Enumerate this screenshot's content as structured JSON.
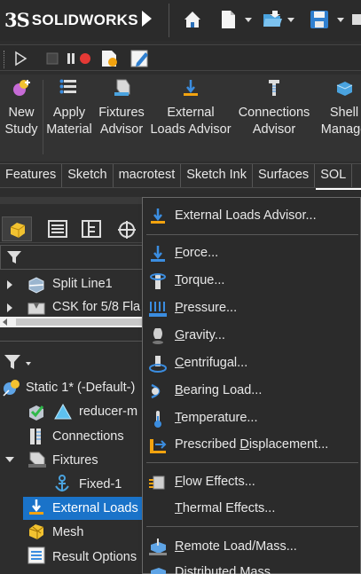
{
  "app": {
    "logo_mark": "3S",
    "logo_text": "SOLIDWORKS"
  },
  "ribbon": {
    "buttons": [
      {
        "line1": "New",
        "line2": "Study",
        "icon": "new-study-icon"
      },
      {
        "line1": "Apply",
        "line2": "Material",
        "icon": "apply-material-icon"
      },
      {
        "line1": "Fixtures",
        "line2": "Advisor",
        "icon": "fixtures-advisor-icon"
      },
      {
        "line1": "External",
        "line2": "Loads Advisor",
        "icon": "external-loads-advisor-icon"
      },
      {
        "line1": "Connections",
        "line2": "Advisor",
        "icon": "connections-advisor-icon"
      },
      {
        "line1": "Shell",
        "line2": "Manage",
        "icon": "shell-manager-icon"
      }
    ]
  },
  "tabs": [
    "Features",
    "Sketch",
    "macrotest",
    "Sketch Ink",
    "Surfaces",
    "SOL"
  ],
  "tree": {
    "top_items": [
      {
        "label": "Split Line1",
        "icon": "split-line-icon"
      },
      {
        "label": "CSK for 5/8 Fla",
        "icon": "hole-wizard-icon"
      }
    ],
    "study": {
      "root": "Static 1* (-Default-)",
      "part": "reducer-m",
      "connections": "Connections",
      "fixtures": "Fixtures",
      "fixed": "Fixed-1",
      "external_loads": "External Loads",
      "mesh": "Mesh",
      "result_options": "Result Options"
    }
  },
  "menu": {
    "items": [
      {
        "pre": "External Loads Advisor...",
        "u": "",
        "post": "",
        "icon": "external-loads-advisor-icon"
      },
      {
        "pre": "",
        "u": "F",
        "post": "orce...",
        "icon": "force-icon"
      },
      {
        "pre": "",
        "u": "T",
        "post": "orque...",
        "icon": "torque-icon"
      },
      {
        "pre": "",
        "u": "P",
        "post": "ressure...",
        "icon": "pressure-icon"
      },
      {
        "pre": "",
        "u": "G",
        "post": "ravity...",
        "icon": "gravity-icon"
      },
      {
        "pre": "",
        "u": "C",
        "post": "entrifugal...",
        "icon": "centrifugal-icon"
      },
      {
        "pre": "",
        "u": "B",
        "post": "earing Load...",
        "icon": "bearing-load-icon"
      },
      {
        "pre": "",
        "u": "T",
        "post": "emperature...",
        "icon": "temperature-icon"
      },
      {
        "pre": "Prescribed ",
        "u": "D",
        "post": "isplacement...",
        "icon": "prescribed-displacement-icon"
      },
      {
        "pre": "",
        "u": "F",
        "post": "low Effects...",
        "icon": "flow-effects-icon"
      },
      {
        "pre": "",
        "u": "T",
        "post": "hermal Effects...",
        "icon": "thermal-effects-icon"
      },
      {
        "pre": "",
        "u": "R",
        "post": "emote Load/Mass...",
        "icon": "remote-load-icon"
      },
      {
        "pre": "Distributed Mass...",
        "u": "",
        "post": "",
        "icon": "distributed-mass-icon"
      }
    ]
  },
  "colors": {
    "accent": "#1a73c9",
    "menu_bg": "#2b2b2b",
    "panel_bg": "#2d2d2d"
  }
}
